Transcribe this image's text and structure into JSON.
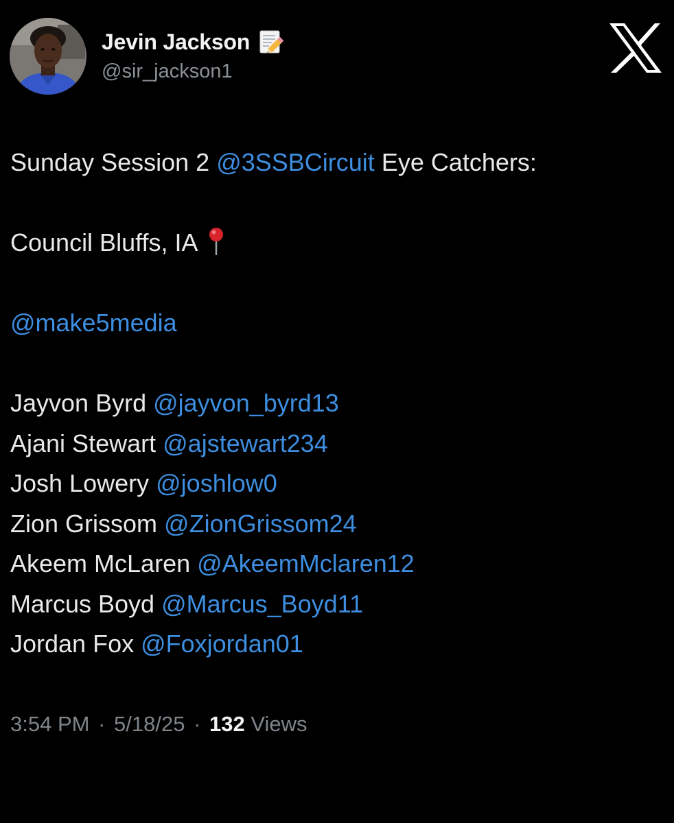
{
  "author": {
    "display_name": "Jevin Jackson",
    "handle": "@sir_jackson1",
    "name_emoji_icon": "memo-pencil-icon"
  },
  "platform_logo": "x-logo-icon",
  "tweet": {
    "line1": {
      "prefix": "Sunday Session 2 ",
      "mention": "@3SSBCircuit",
      "suffix": " Eye Catchers:"
    },
    "location": {
      "text": "Council Bluffs, IA",
      "icon": "round-pushpin-icon"
    },
    "media_mention": "@make5media",
    "players": [
      {
        "name": "Jayvon Byrd",
        "handle": "@jayvon_byrd13"
      },
      {
        "name": "Ajani Stewart",
        "handle": "@ajstewart234"
      },
      {
        "name": "Josh Lowery",
        "handle": "@joshlow0"
      },
      {
        "name": "Zion Grissom",
        "handle": "@ZionGrissom24"
      },
      {
        "name": "Akeem McLaren",
        "handle": "@AkeemMclaren12"
      },
      {
        "name": "Marcus Boyd",
        "handle": "@Marcus_Boyd11"
      },
      {
        "name": "Jordan Fox",
        "handle": "@Foxjordan01"
      }
    ]
  },
  "meta": {
    "time": "3:54 PM",
    "separator": "·",
    "date": "5/18/25",
    "views_count": "132",
    "views_label": "Views"
  },
  "colors": {
    "background": "#000000",
    "text": "#e7e9ea",
    "mention": "#3d8ee0",
    "muted": "#7e848a"
  }
}
